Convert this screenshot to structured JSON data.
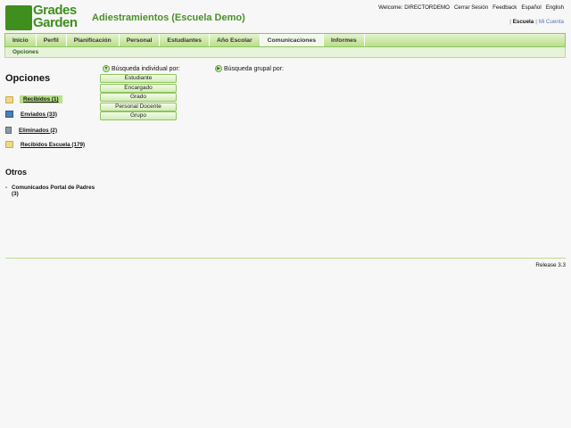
{
  "header": {
    "logo_line1": "Grades",
    "logo_line2": "Garden",
    "app_title": "Adiestramientos (Escuela Demo)",
    "top_links": [
      "Welcome: DIRECTORDEMO",
      "Cerrar Sesión",
      "Feedback",
      "Español",
      "English"
    ],
    "account": {
      "escuela": "Escuela",
      "mi_cuenta": "Mi Cuenta"
    }
  },
  "nav": {
    "tabs": [
      "Inicio",
      "Perfil",
      "Planificación",
      "Personal",
      "Estudiantes",
      "Año Escolar",
      "Comunicaciones",
      "Informes"
    ],
    "active": "Comunicaciones",
    "subnav": "Opciones"
  },
  "sidebar": {
    "title": "Opciones",
    "items": [
      {
        "label": "Recibidos (1)",
        "icon": "folder-icon"
      },
      {
        "label": "Enviados (33)",
        "icon": "outbox-icon"
      },
      {
        "label": "Eliminados (2)",
        "icon": "trash-icon"
      },
      {
        "label": "Recibidos Escuela (179)",
        "icon": "folder-icon"
      }
    ],
    "otros_title": "Otros",
    "otros_item": "Comunicados Portal de Padres",
    "otros_count": "(3)"
  },
  "search": {
    "individual_title": "Búsqueda individual por:",
    "group_title": "Búsqueda grupal por:",
    "buttons": [
      "Estudiante",
      "Encargado",
      "Grado",
      "Personal Docente",
      "Grupo"
    ]
  },
  "footer": {
    "release": "Release 3.3"
  },
  "colors": {
    "brand_green": "#3f8f1e",
    "nav_green": "#b8df8b"
  }
}
